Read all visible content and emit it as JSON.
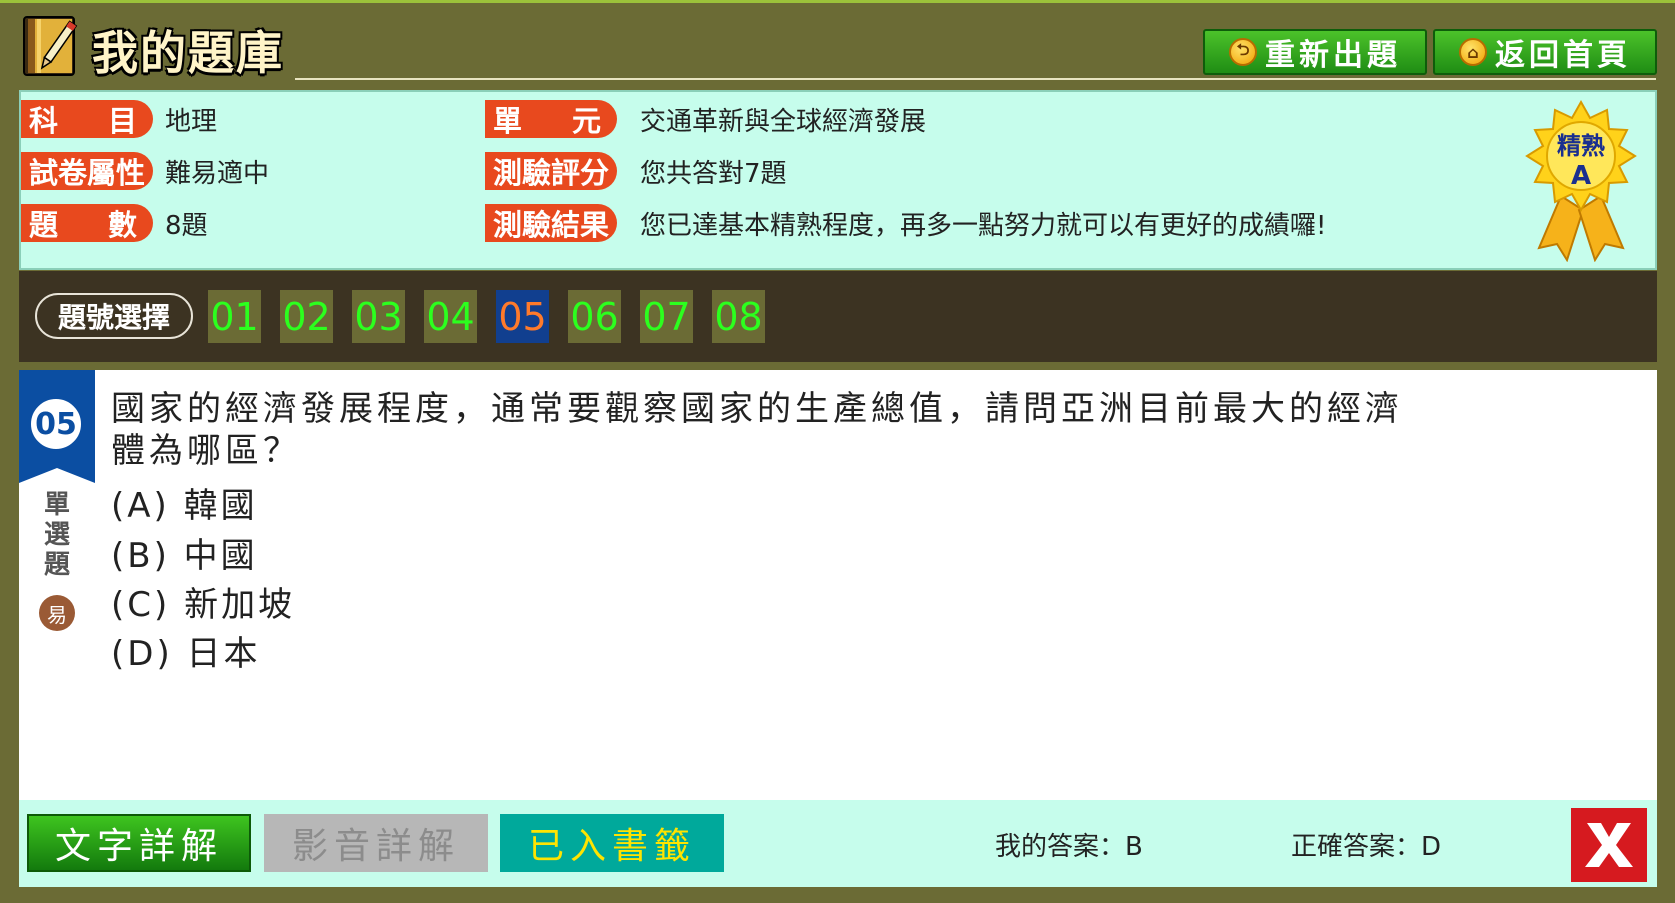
{
  "header": {
    "title": "我的題庫",
    "btn_reset": "重新出題",
    "btn_home": "返回首頁"
  },
  "info": {
    "subject_label": "科　　目",
    "subject_value": "地理",
    "unit_label": "單　　元",
    "unit_value": "交通革新與全球經濟發展",
    "attr_label": "試卷屬性",
    "attr_value": "難易適中",
    "score_label": "測驗評分",
    "score_value": "您共答對7題",
    "count_label": "題　　數",
    "count_value": "8題",
    "result_label": "測驗結果",
    "result_value": "您已達基本精熟程度，再多一點努力就可以有更好的成績囉!",
    "medal_line1": "精熟",
    "medal_line2": "A"
  },
  "nav": {
    "label": "題號選擇",
    "numbers": [
      "01",
      "02",
      "03",
      "04",
      "05",
      "06",
      "07",
      "08"
    ],
    "active": "05"
  },
  "question": {
    "number": "05",
    "type": "單選題",
    "level": "易",
    "text": "國家的經濟發展程度，通常要觀察國家的生產總值，請問亞洲目前最大的經濟體為哪區？",
    "options": [
      "(A) 韓國",
      "(B) 中國",
      "(C) 新加坡",
      "(D) 日本"
    ]
  },
  "bottom": {
    "btn_text_explain": "文字詳解",
    "btn_video_explain": "影音詳解",
    "btn_bookmark": "已入書籤",
    "my_answer": "我的答案：B",
    "correct_answer": "正確答案：D"
  },
  "colors": {
    "background": "#6b6b35",
    "panel": "#c6fdec",
    "tag": "#e8491e",
    "nav_bg": "#3c3322",
    "active_num": "#113f8f",
    "num_text": "#2cff1e",
    "close": "#d61a1f"
  }
}
